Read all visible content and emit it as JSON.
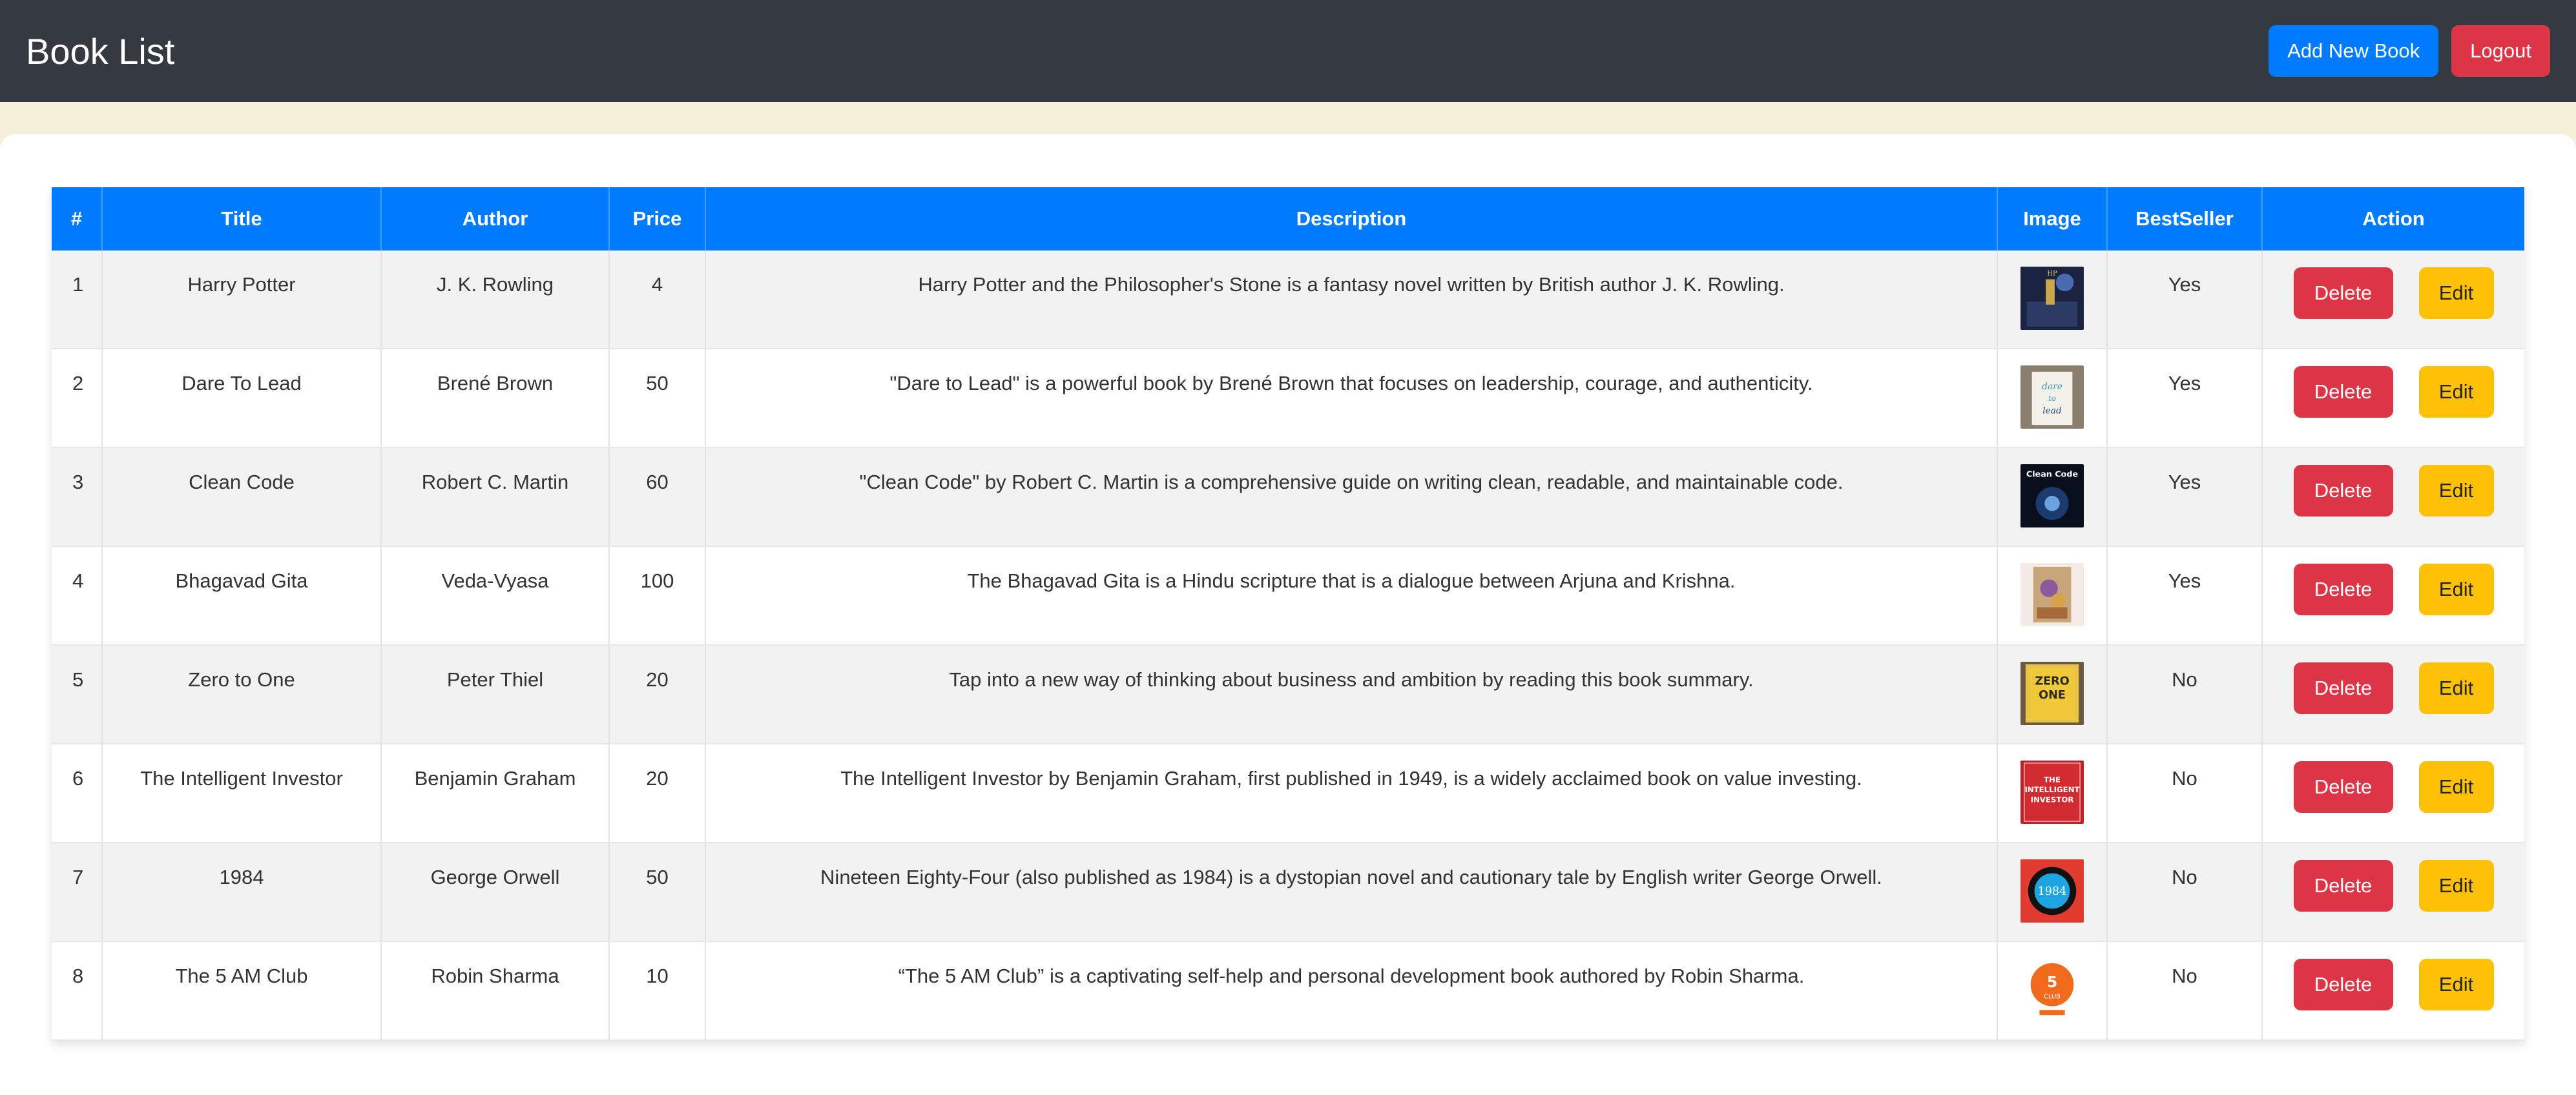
{
  "header": {
    "title": "Book List",
    "add_label": "Add New Book",
    "logout_label": "Logout"
  },
  "table": {
    "columns": [
      "#",
      "Title",
      "Author",
      "Price",
      "Description",
      "Image",
      "BestSeller",
      "Action"
    ],
    "delete_label": "Delete",
    "edit_label": "Edit",
    "rows": [
      {
        "num": "1",
        "title": "Harry Potter",
        "author": "J. K. Rowling",
        "price": "4",
        "description": "Harry Potter and the Philosopher's Stone is a fantasy novel written by British author J. K. Rowling.",
        "bestseller": "Yes",
        "cover": "harry-potter-cover"
      },
      {
        "num": "2",
        "title": "Dare To Lead",
        "author": "Brené Brown",
        "price": "50",
        "description": "\"Dare to Lead\" is a powerful book by Brené Brown that focuses on leadership, courage, and authenticity.",
        "bestseller": "Yes",
        "cover": "dare-to-lead-cover"
      },
      {
        "num": "3",
        "title": "Clean Code",
        "author": "Robert C. Martin",
        "price": "60",
        "description": "\"Clean Code\" by Robert C. Martin is a comprehensive guide on writing clean, readable, and maintainable code.",
        "bestseller": "Yes",
        "cover": "clean-code-cover"
      },
      {
        "num": "4",
        "title": "Bhagavad Gita",
        "author": "Veda-Vyasa",
        "price": "100",
        "description": "The Bhagavad Gita is a Hindu scripture that is a dialogue between Arjuna and Krishna.",
        "bestseller": "Yes",
        "cover": "bhagavad-gita-cover"
      },
      {
        "num": "5",
        "title": "Zero to One",
        "author": "Peter Thiel",
        "price": "20",
        "description": "Tap into a new way of thinking about business and ambition by reading this book summary.",
        "bestseller": "No",
        "cover": "zero-to-one-cover"
      },
      {
        "num": "6",
        "title": "The Intelligent Investor",
        "author": "Benjamin Graham",
        "price": "20",
        "description": "The Intelligent Investor by Benjamin Graham, first published in 1949, is a widely acclaimed book on value investing.",
        "bestseller": "No",
        "cover": "intelligent-investor-cover"
      },
      {
        "num": "7",
        "title": "1984",
        "author": "George Orwell",
        "price": "50",
        "description": "Nineteen Eighty-Four (also published as 1984) is a dystopian novel and cautionary tale by English writer George Orwell.",
        "bestseller": "No",
        "cover": "1984-cover"
      },
      {
        "num": "8",
        "title": "The 5 AM Club",
        "author": "Robin Sharma",
        "price": "10",
        "description": "“The 5 AM Club” is a captivating self-help and personal development book authored by Robin Sharma.",
        "bestseller": "No",
        "cover": "5am-club-cover"
      }
    ]
  },
  "colors": {
    "navbar": "#343a40",
    "primary": "#007bff",
    "danger": "#dc3545",
    "warning": "#ffc107",
    "page_bg": "#f6f0da"
  }
}
